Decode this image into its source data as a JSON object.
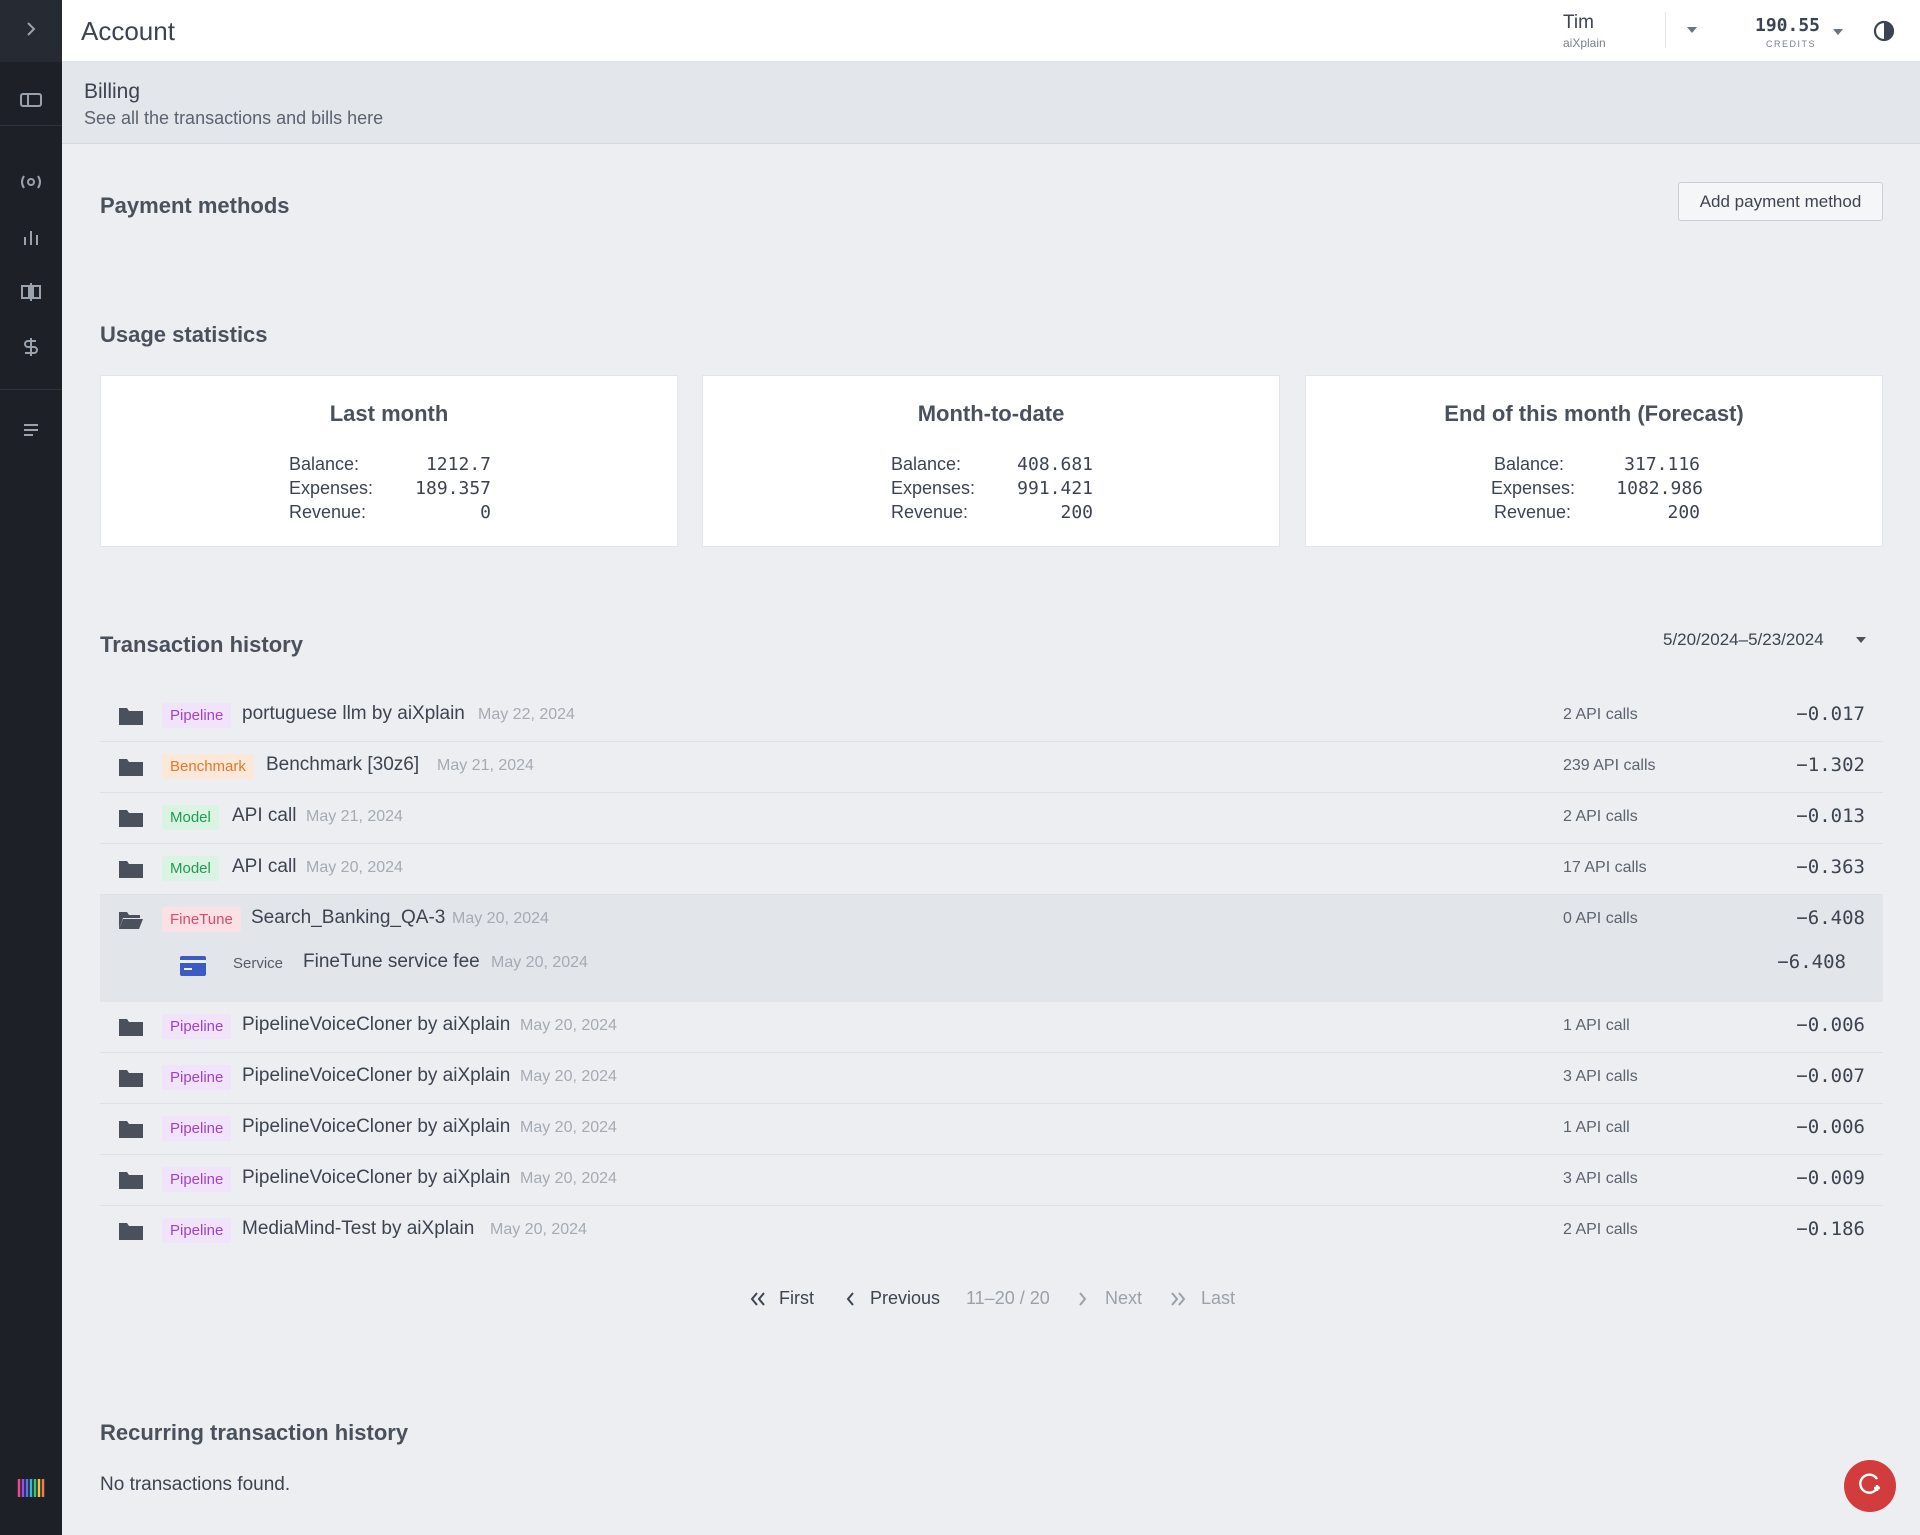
{
  "header": {
    "title": "Account"
  },
  "user": {
    "name": "Tim",
    "org": "aiXplain"
  },
  "credits": {
    "value": "190.55",
    "label": "CREDITS"
  },
  "billing": {
    "title": "Billing",
    "subtitle": "See all the transactions and bills here"
  },
  "payment_methods": {
    "title": "Payment methods",
    "add_label": "Add payment method"
  },
  "usage": {
    "title": "Usage statistics",
    "cards": [
      {
        "title": "Last month",
        "balance_label": "Balance:",
        "balance": "1212.7",
        "expenses_label": "Expenses:",
        "expenses": "189.357",
        "revenue_label": "Revenue:",
        "revenue": "0"
      },
      {
        "title": "Month-to-date",
        "balance_label": "Balance:",
        "balance": "408.681",
        "expenses_label": "Expenses:",
        "expenses": "991.421",
        "revenue_label": "Revenue:",
        "revenue": "200"
      },
      {
        "title": "End of this month (Forecast)",
        "balance_label": "Balance:",
        "balance": "317.116",
        "expenses_label": "Expenses:",
        "expenses": "1082.986",
        "revenue_label": "Revenue:",
        "revenue": "200"
      }
    ]
  },
  "transactions": {
    "title": "Transaction history",
    "date_range": "5/20/2024–5/23/2024",
    "rows": [
      {
        "type": "Pipeline",
        "name": "portuguese llm by aiXplain",
        "date": "May 22, 2024",
        "calls": "2 API calls",
        "amount": "−0.017"
      },
      {
        "type": "Benchmark",
        "name": "Benchmark [30z6]",
        "date": "May 21, 2024",
        "calls": "239 API calls",
        "amount": "−1.302"
      },
      {
        "type": "Model",
        "name": "API call",
        "date": "May 21, 2024",
        "calls": "2 API calls",
        "amount": "−0.013"
      },
      {
        "type": "Model",
        "name": "API call",
        "date": "May 20, 2024",
        "calls": "17 API calls",
        "amount": "−0.363"
      },
      {
        "type": "FineTune",
        "name": "Search_Banking_QA-3",
        "date": "May 20, 2024",
        "calls": "0 API calls",
        "amount": "−6.408"
      },
      {
        "type": "Pipeline",
        "name": "PipelineVoiceCloner by aiXplain",
        "date": "May 20, 2024",
        "calls": "1 API call",
        "amount": "−0.006"
      },
      {
        "type": "Pipeline",
        "name": "PipelineVoiceCloner by aiXplain",
        "date": "May 20, 2024",
        "calls": "3 API calls",
        "amount": "−0.007"
      },
      {
        "type": "Pipeline",
        "name": "PipelineVoiceCloner by aiXplain",
        "date": "May 20, 2024",
        "calls": "1 API call",
        "amount": "−0.006"
      },
      {
        "type": "Pipeline",
        "name": "PipelineVoiceCloner by aiXplain",
        "date": "May 20, 2024",
        "calls": "3 API calls",
        "amount": "−0.009"
      },
      {
        "type": "Pipeline",
        "name": "MediaMind-Test by aiXplain",
        "date": "May 20, 2024",
        "calls": "2 API calls",
        "amount": "−0.186"
      }
    ],
    "sub_row": {
      "type": "Service",
      "name": "FineTune service fee",
      "date": "May 20, 2024",
      "amount": "−6.408"
    }
  },
  "pagination": {
    "first": "First",
    "previous": "Previous",
    "range": "11–20 / 20",
    "next": "Next",
    "last": "Last"
  },
  "recurring": {
    "title": "Recurring transaction history",
    "empty": "No transactions found."
  },
  "colors": {
    "sidebar": "#1d2127",
    "accent_red": "#d23c3c",
    "pipeline": "#a13fd0",
    "benchmark": "#e07a2e",
    "model": "#1f9d4f",
    "finetune": "#e04a6a"
  },
  "icons": {
    "sidebar": [
      "chevron-right-icon",
      "dashboard-icon",
      "broadcast-icon",
      "bar-chart-icon",
      "compare-icon",
      "billing-icon",
      "list-icon",
      "brand-logo-icon"
    ],
    "theme": "contrast-icon",
    "fab": "support-icon"
  }
}
